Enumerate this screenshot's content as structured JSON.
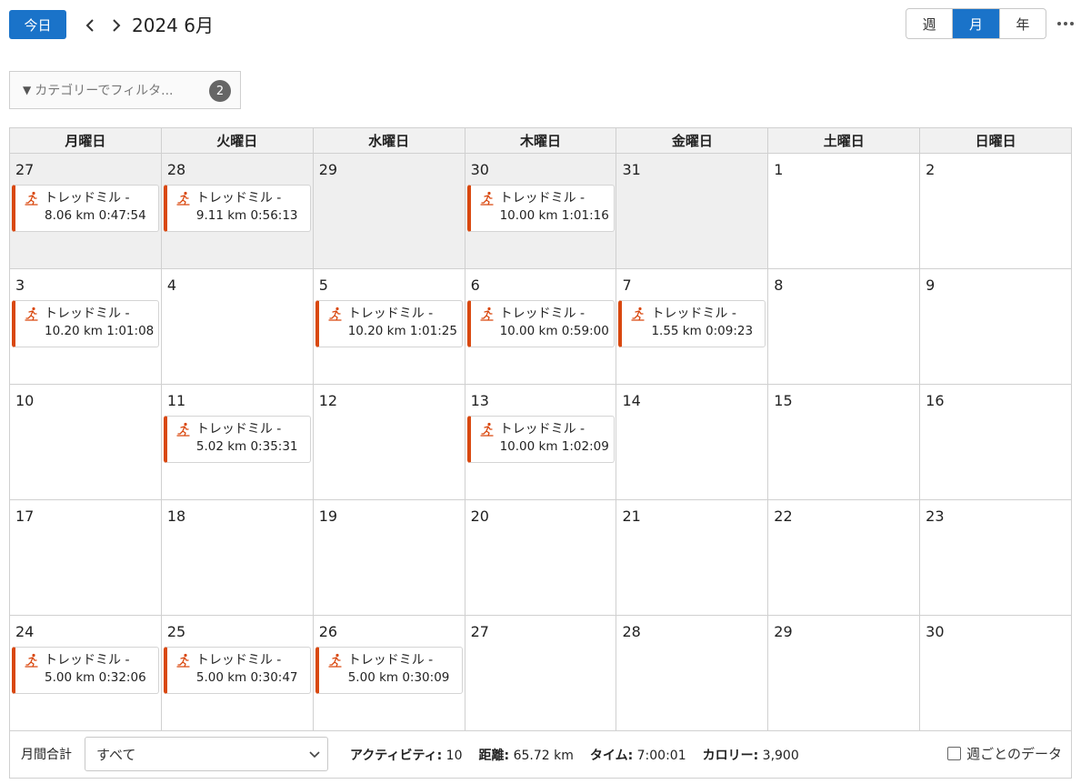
{
  "header": {
    "today_label": "今日",
    "title": "2024 6月",
    "views": [
      "週",
      "月",
      "年"
    ],
    "active_view": "月"
  },
  "filter": {
    "placeholder": "カテゴリーでフィルタ...",
    "count": "2"
  },
  "weekdays": [
    "月曜日",
    "火曜日",
    "水曜日",
    "木曜日",
    "金曜日",
    "土曜日",
    "日曜日"
  ],
  "accent_color": "#1a73c9",
  "event_color": "#d9480f",
  "weeks": [
    [
      {
        "day": "27",
        "other": true,
        "event": {
          "title": "トレッドミル -",
          "detail": "8.06 km 0:47:54"
        }
      },
      {
        "day": "28",
        "other": true,
        "event": {
          "title": "トレッドミル -",
          "detail": "9.11 km 0:56:13"
        }
      },
      {
        "day": "29",
        "other": true,
        "event": null
      },
      {
        "day": "30",
        "other": true,
        "event": {
          "title": "トレッドミル -",
          "detail": "10.00 km 1:01:16"
        }
      },
      {
        "day": "31",
        "other": true,
        "event": null
      },
      {
        "day": "1",
        "other": false,
        "event": null
      },
      {
        "day": "2",
        "other": false,
        "event": null
      }
    ],
    [
      {
        "day": "3",
        "other": false,
        "event": {
          "title": "トレッドミル -",
          "detail": "10.20 km 1:01:08"
        }
      },
      {
        "day": "4",
        "other": false,
        "event": null
      },
      {
        "day": "5",
        "other": false,
        "event": {
          "title": "トレッドミル -",
          "detail": "10.20 km 1:01:25"
        }
      },
      {
        "day": "6",
        "other": false,
        "event": {
          "title": "トレッドミル -",
          "detail": "10.00 km 0:59:00"
        }
      },
      {
        "day": "7",
        "other": false,
        "event": {
          "title": "トレッドミル -",
          "detail": "1.55 km 0:09:23"
        }
      },
      {
        "day": "8",
        "other": false,
        "event": null
      },
      {
        "day": "9",
        "other": false,
        "event": null
      }
    ],
    [
      {
        "day": "10",
        "other": false,
        "event": null
      },
      {
        "day": "11",
        "other": false,
        "event": {
          "title": "トレッドミル -",
          "detail": "5.02 km 0:35:31"
        }
      },
      {
        "day": "12",
        "other": false,
        "event": null
      },
      {
        "day": "13",
        "other": false,
        "event": {
          "title": "トレッドミル -",
          "detail": "10.00 km 1:02:09"
        }
      },
      {
        "day": "14",
        "other": false,
        "event": null
      },
      {
        "day": "15",
        "other": false,
        "event": null
      },
      {
        "day": "16",
        "other": false,
        "event": null
      }
    ],
    [
      {
        "day": "17",
        "other": false,
        "event": null
      },
      {
        "day": "18",
        "other": false,
        "event": null
      },
      {
        "day": "19",
        "other": false,
        "event": null
      },
      {
        "day": "20",
        "other": false,
        "event": null
      },
      {
        "day": "21",
        "other": false,
        "event": null
      },
      {
        "day": "22",
        "other": false,
        "event": null
      },
      {
        "day": "23",
        "other": false,
        "event": null
      }
    ],
    [
      {
        "day": "24",
        "other": false,
        "event": {
          "title": "トレッドミル -",
          "detail": "5.00 km 0:32:06"
        }
      },
      {
        "day": "25",
        "other": false,
        "event": {
          "title": "トレッドミル -",
          "detail": "5.00 km 0:30:47"
        }
      },
      {
        "day": "26",
        "other": false,
        "event": {
          "title": "トレッドミル -",
          "detail": "5.00 km 0:30:09"
        }
      },
      {
        "day": "27",
        "other": false,
        "event": null
      },
      {
        "day": "28",
        "other": false,
        "event": null
      },
      {
        "day": "29",
        "other": false,
        "event": null
      },
      {
        "day": "30",
        "other": false,
        "event": null
      }
    ]
  ],
  "footer": {
    "label": "月間合計",
    "select_value": "すべて",
    "stats": [
      {
        "label": "アクティビティ:",
        "value": "10"
      },
      {
        "label": "距離:",
        "value": "65.72 km"
      },
      {
        "label": "タイム:",
        "value": "7:00:01"
      },
      {
        "label": "カロリー:",
        "value": "3,900"
      }
    ],
    "weekly_label": "週ごとのデータ",
    "weekly_checked": false
  }
}
